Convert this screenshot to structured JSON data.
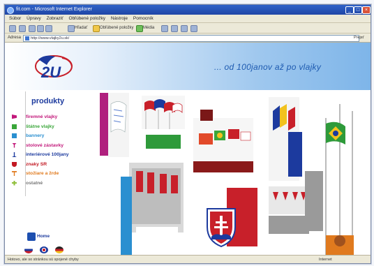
{
  "browser": {
    "title": "fit.com - Microsoft Internet Explorer",
    "menu": [
      "Súbor",
      "Úpravy",
      "Zobraziť",
      "Obľúbené položky",
      "Nástroje",
      "Pomocník"
    ],
    "toolbar": {
      "search_label": "Hľadať",
      "favorites_label": "Obľúbené položky",
      "media_label": "Média"
    },
    "address_label": "Adresa",
    "address_value": "http://www.vlajky2u.sk/",
    "go_label": "Prejsť",
    "status_left": "Hotovo, ale so stránkou sú spojené chyby",
    "status_right": "Internet"
  },
  "site": {
    "logo_text": "2U",
    "slogan": "... od 100janov až po vlajky",
    "products_title": "produkty",
    "nav": [
      {
        "label": "firemné vlajky",
        "color": "#c2187a",
        "icon_color": "#c2187a"
      },
      {
        "label": "štátne vlajky",
        "color": "#3aa63a",
        "icon_color": "#3aa63a"
      },
      {
        "label": "bannery",
        "color": "#2a8fd0",
        "icon_color": "#2a8fd0"
      },
      {
        "label": "stolové zástavky",
        "color": "#c2187a",
        "icon_color": "#c2187a"
      },
      {
        "label": "interiérové 100jany",
        "color": "#1c3a9e",
        "icon_color": "#1c3a9e"
      },
      {
        "label": "znaky SR",
        "color": "#c21822",
        "icon_color": "#c21822"
      },
      {
        "label": "stožiare a žrde",
        "color": "#e07a1e",
        "icon_color": "#e07a1e"
      },
      {
        "label": "ostatné",
        "color": "#777777",
        "icon_color": "#8fbf3a"
      }
    ],
    "home_label": "Home",
    "languages": [
      "sk",
      "en",
      "de"
    ]
  }
}
